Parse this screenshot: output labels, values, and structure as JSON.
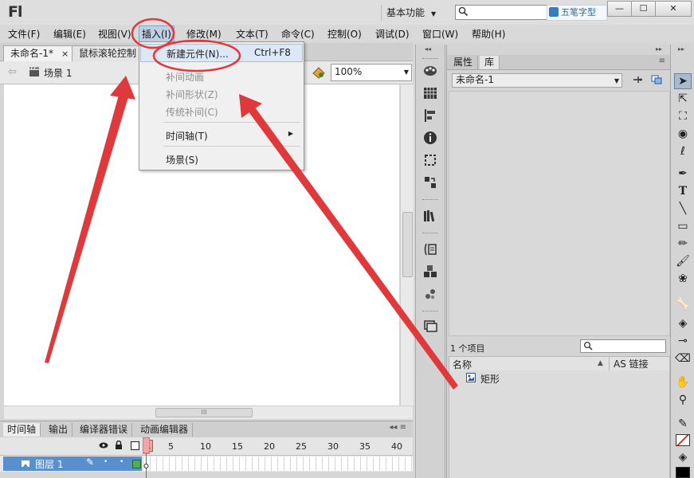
{
  "app": {
    "logo": "Fl",
    "workspace": "基本功能",
    "watermark": "五笔字型"
  },
  "window_buttons": {
    "minimize": "—",
    "maximize": "☐",
    "close": "✕"
  },
  "menubar": [
    "文件(F)",
    "编辑(E)",
    "视图(V)",
    "插入(I)",
    "修改(M)",
    "文本(T)",
    "命令(C)",
    "控制(O)",
    "调试(D)",
    "窗口(W)",
    "帮助(H)"
  ],
  "doc_tabs": [
    {
      "label": "未命名-1*",
      "close": "×"
    },
    {
      "label": "鼠标滚轮控制"
    }
  ],
  "edit_bar": {
    "scene": "场景 1",
    "zoom": "100%"
  },
  "insert_menu": {
    "items": [
      {
        "label": "新建元件(N)...",
        "shortcut": "Ctrl+F8"
      },
      {
        "label": "补间动画"
      },
      {
        "label": "补间形状(Z)"
      },
      {
        "label": "传统补间(C)"
      },
      {
        "label": "时间轴(T)"
      },
      {
        "label": "场景(S)"
      }
    ]
  },
  "timeline": {
    "tabs": [
      "时间轴",
      "输出",
      "编译器错误",
      "动画编辑器"
    ],
    "frame_numbers": [
      "1",
      "5",
      "10",
      "15",
      "20",
      "25",
      "30",
      "35",
      "40"
    ],
    "layer": "图层 1"
  },
  "library": {
    "tabs": [
      "属性",
      "库"
    ],
    "document": "未命名-1",
    "item_count": "1 个项目",
    "columns": {
      "name": "名称",
      "linkage": "AS 链接"
    },
    "items": [
      "矩形"
    ]
  },
  "colors": {
    "annotation": "#e0393c",
    "selection": "#5a8fce",
    "menu_highlight": "#dde8f7"
  }
}
